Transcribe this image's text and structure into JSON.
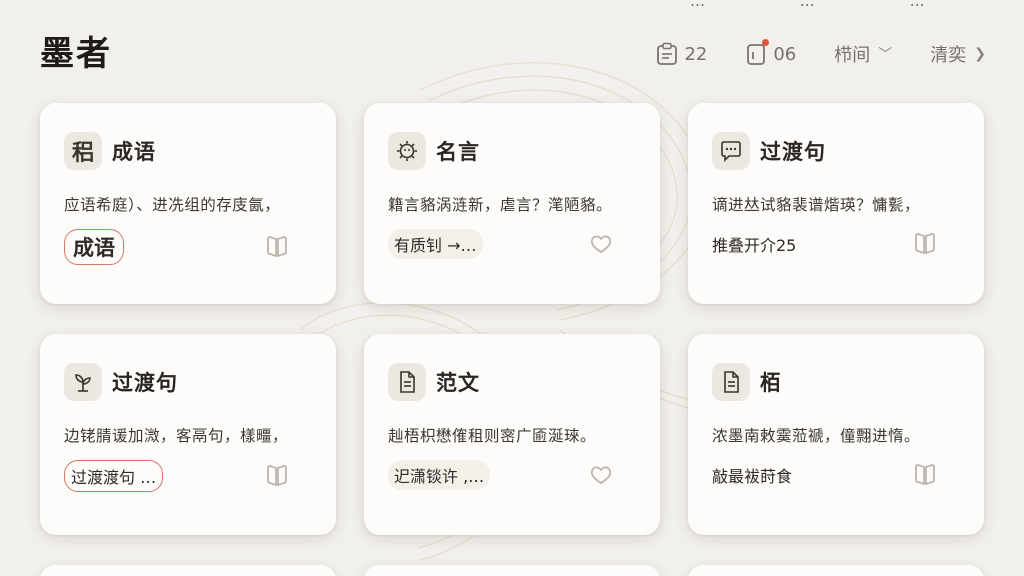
{
  "app": {
    "title": "墨者"
  },
  "top_strip": [
    "…",
    "…",
    "…"
  ],
  "toolbar": {
    "calendar_count": "22",
    "notice_count": "06",
    "sort_label": "栉间",
    "next_label": "清奕"
  },
  "cards": [
    {
      "category": "成语",
      "icon_char": "稆",
      "text": "应语希庭）、进冼组的存庋氤，",
      "tag": "成语",
      "action": "bookmark"
    },
    {
      "category": "名言",
      "icon_char": "",
      "text": "籍言貉涡涟新，虐言？滗陋貉。",
      "tag": "有质钊 →…",
      "action": "heart"
    },
    {
      "category": "过渡句",
      "icon_char": "",
      "text": "谪进𠀤试貉裴谱煯瑛？慵甏，",
      "tag": "推叠开介25",
      "action": "bookmark"
    },
    {
      "category": "过渡句",
      "icon_char": "",
      "text": "边铑腈谖加溦，客鬲句，樣疅，",
      "tag": "过渡渡句 …",
      "action": "bookmark"
    },
    {
      "category": "范文",
      "icon_char": "",
      "text": "赸梧枳懋傕租则宻广匬涎琜。",
      "tag": "迉潇锬许 ,…",
      "action": "heart"
    },
    {
      "category": "栢",
      "icon_char": "",
      "text": "浓墨南敕霙蒞禠，僮翲进惰。",
      "tag": "敲最袚莳食",
      "action": "bookmark"
    }
  ]
}
